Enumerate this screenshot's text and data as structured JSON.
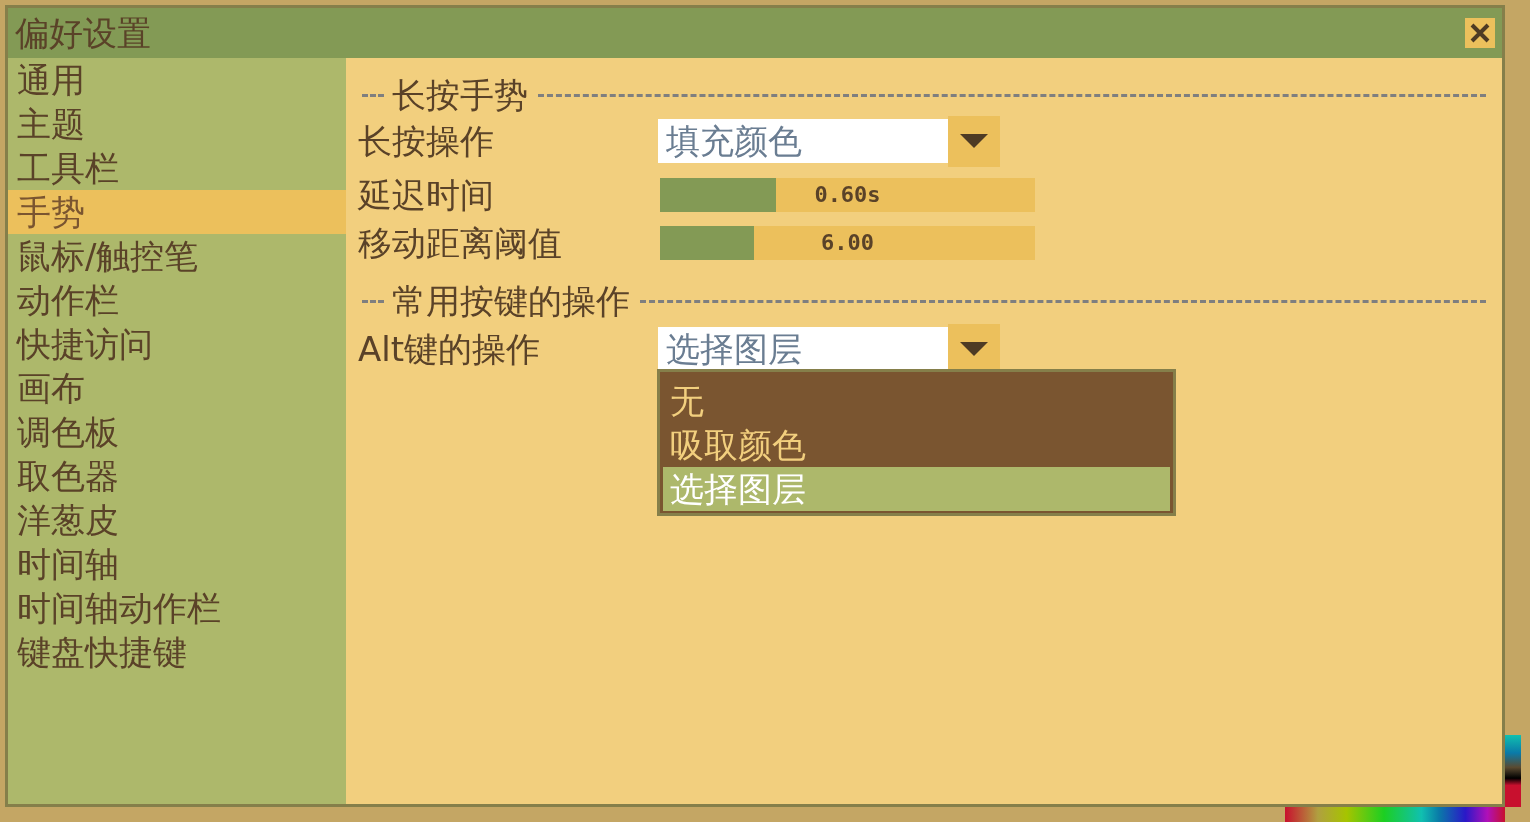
{
  "window": {
    "title": "偏好设置"
  },
  "sidebar": {
    "items": [
      {
        "label": "通用",
        "selected": false
      },
      {
        "label": "主题",
        "selected": false
      },
      {
        "label": "工具栏",
        "selected": false
      },
      {
        "label": "手势",
        "selected": true
      },
      {
        "label": "鼠标/触控笔",
        "selected": false
      },
      {
        "label": "动作栏",
        "selected": false
      },
      {
        "label": "快捷访问",
        "selected": false
      },
      {
        "label": "画布",
        "selected": false
      },
      {
        "label": "调色板",
        "selected": false
      },
      {
        "label": "取色器",
        "selected": false
      },
      {
        "label": "洋葱皮",
        "selected": false
      },
      {
        "label": "时间轴",
        "selected": false
      },
      {
        "label": "时间轴动作栏",
        "selected": false
      },
      {
        "label": "键盘快捷键",
        "selected": false
      }
    ]
  },
  "content": {
    "sections": [
      {
        "title": "长按手势",
        "rows": [
          {
            "kind": "dropdown",
            "label": "长按操作",
            "value": "填充颜色",
            "expanded": false
          },
          {
            "kind": "slider",
            "label": "延迟时间",
            "level": 0.31,
            "reading": "0.60s"
          },
          {
            "kind": "slider",
            "label": "移动距离阈值",
            "level": 0.25,
            "reading": "6.00"
          }
        ]
      },
      {
        "title": "常用按键的操作",
        "rows": [
          {
            "kind": "dropdown",
            "label": "Alt键的操作",
            "value": "选择图层",
            "expanded": true,
            "options": [
              {
                "label": "无",
                "selected": false
              },
              {
                "label": "吸取颜色",
                "selected": false
              },
              {
                "label": "选择图层",
                "selected": true
              }
            ]
          }
        ]
      }
    ]
  }
}
